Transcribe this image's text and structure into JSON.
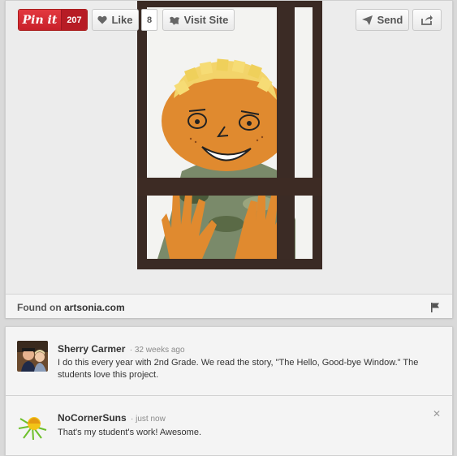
{
  "toolbar": {
    "pinit_label": "Pin it",
    "pinit_count": "207",
    "like_label": "Like",
    "like_count": "8",
    "visit_label": "Visit Site",
    "send_label": "Send"
  },
  "source": {
    "prefix": "Found on ",
    "domain": "artsonia.com"
  },
  "comments": [
    {
      "author": "Sherry Carmer",
      "time": "· 32 weeks ago",
      "text": "I do this every year with 2nd Grade. We read the story, \"The Hello, Good-bye Window.\" The students love this project."
    },
    {
      "author": "NoCornerSuns",
      "time": "· just now",
      "text": "That's my student's work! Awesome."
    }
  ],
  "icons": {
    "like": "heart-icon",
    "visit": "globe-icon",
    "send": "paper-plane-icon",
    "share": "share-arrow-icon",
    "report": "flag-icon",
    "dismiss": "close-icon"
  },
  "colors": {
    "pinit_red": "#d12a30",
    "card_bg": "#ececec"
  }
}
